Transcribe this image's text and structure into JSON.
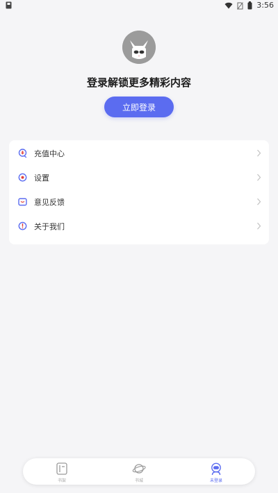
{
  "status_bar": {
    "time": "3:56"
  },
  "profile": {
    "prompt": "登录解锁更多精彩内容",
    "login_button": "立即登录"
  },
  "menu": [
    {
      "label": "充值中心",
      "icon": "wallet-icon"
    },
    {
      "label": "设置",
      "icon": "gear-icon"
    },
    {
      "label": "意见反馈",
      "icon": "feedback-icon"
    },
    {
      "label": "关于我们",
      "icon": "info-icon"
    }
  ],
  "bottom_nav": [
    {
      "label": "书架",
      "icon": "bookshelf-icon",
      "active": false
    },
    {
      "label": "书城",
      "icon": "planet-icon",
      "active": false
    },
    {
      "label": "未登录",
      "icon": "astronaut-icon",
      "active": true
    }
  ],
  "colors": {
    "accent": "#5b6cf0",
    "background": "#f5f5f7",
    "card": "#ffffff"
  }
}
